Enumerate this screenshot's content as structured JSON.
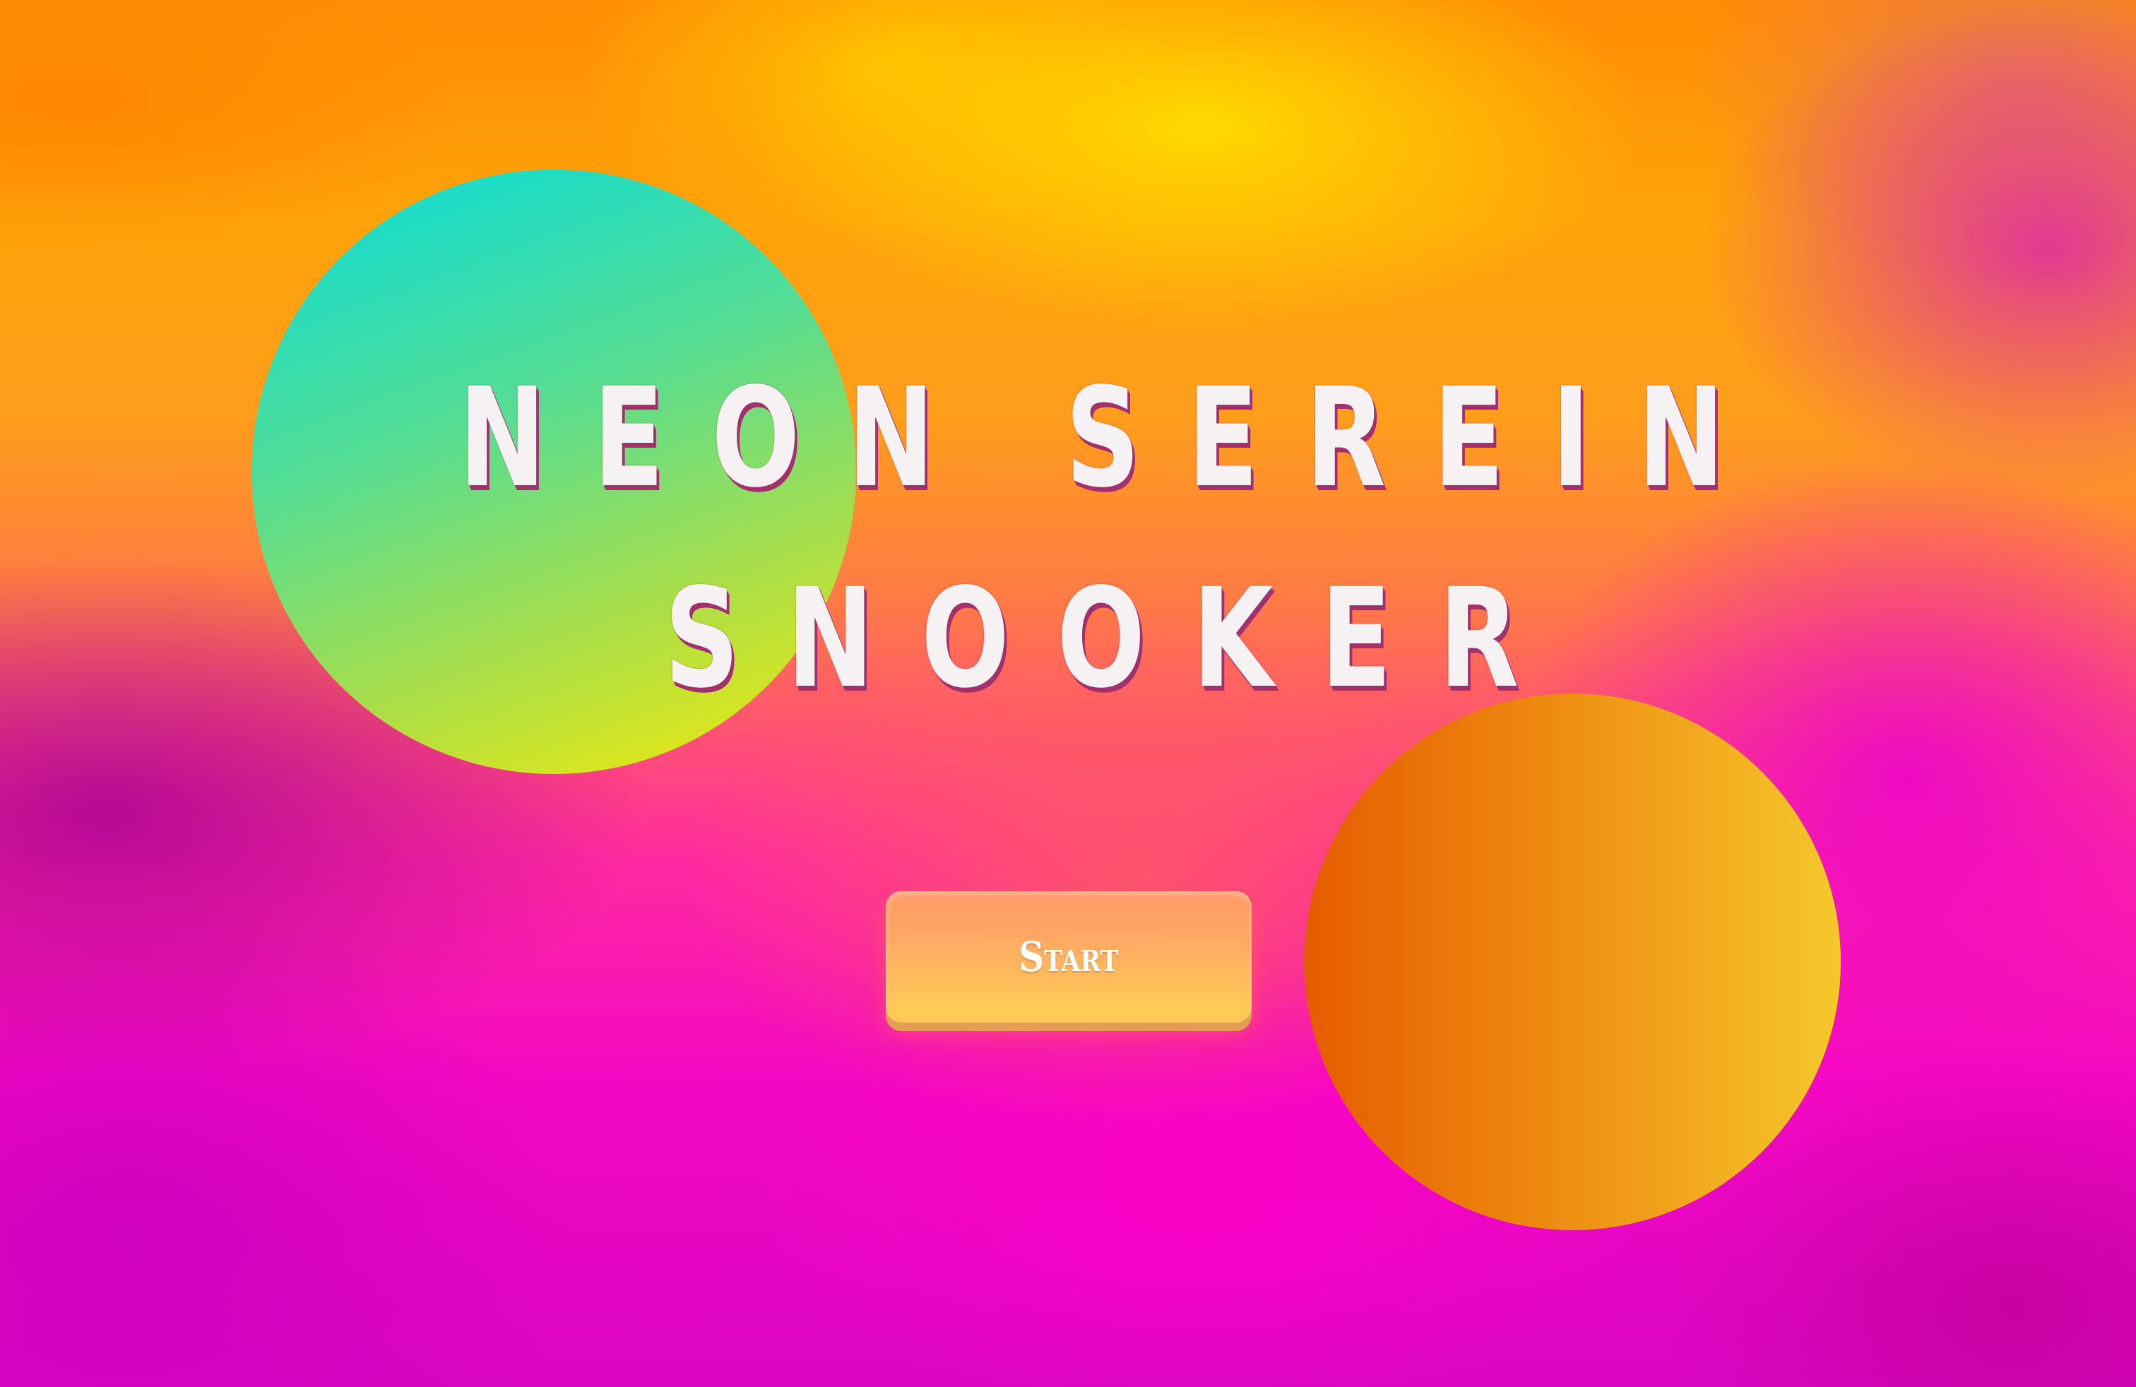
{
  "game": {
    "title_line1": "NEON SEREIN",
    "title_line2": "SNOOKER",
    "start_label": "Start"
  },
  "colors": {
    "background_primary": "#ff2aa0",
    "background_warm": "#ffa30a",
    "ball_teal_top": "#07dcdb",
    "ball_teal_bottom": "#f4ea07",
    "ball_orange_left": "#e55b00",
    "ball_orange_right": "#f4c82c",
    "title_text": "#f6f2f4",
    "title_shadow": "#a1306c",
    "button_top": "#ff9a68",
    "button_bottom": "#ffd552"
  }
}
